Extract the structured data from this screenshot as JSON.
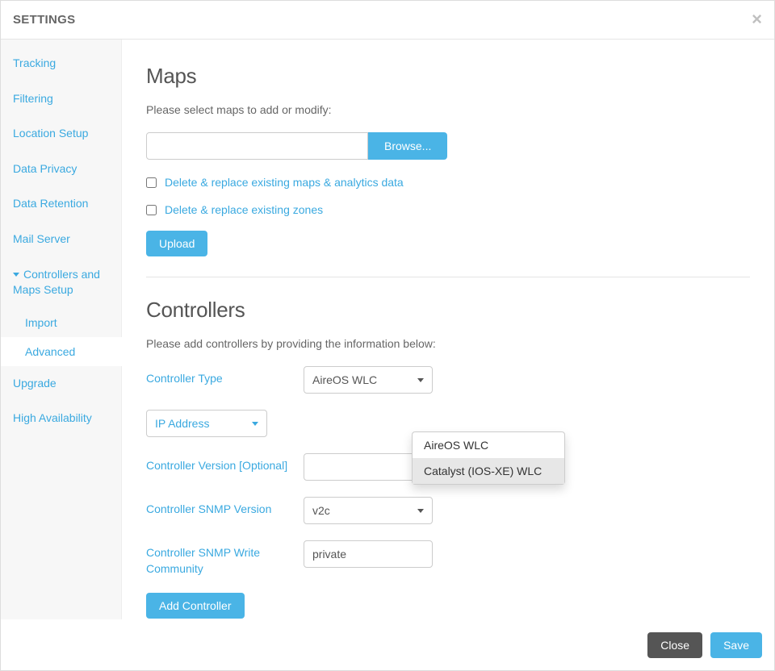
{
  "header": {
    "title": "SETTINGS"
  },
  "sidebar": {
    "items": [
      {
        "label": "Tracking"
      },
      {
        "label": "Filtering"
      },
      {
        "label": "Location Setup"
      },
      {
        "label": "Data Privacy"
      },
      {
        "label": "Data Retention"
      },
      {
        "label": "Mail Server"
      },
      {
        "label": "Controllers and Maps Setup"
      },
      {
        "label": "Upgrade"
      },
      {
        "label": "High Availability"
      }
    ],
    "sub": {
      "import": "Import",
      "advanced": "Advanced"
    }
  },
  "maps": {
    "title": "Maps",
    "helper": "Please select maps to add or modify:",
    "browse_label": "Browse...",
    "opt_replace_maps": "Delete & replace existing maps & analytics data",
    "opt_replace_zones": "Delete & replace existing zones",
    "upload_label": "Upload"
  },
  "controllers": {
    "title": "Controllers",
    "helper": "Please add controllers by providing the information below:",
    "type_label": "Controller Type",
    "type_value": "AireOS WLC",
    "type_options": {
      "a": "AireOS WLC",
      "b": "Catalyst (IOS-XE) WLC"
    },
    "ip_label": "IP Address",
    "version_label": "Controller Version [Optional]",
    "snmp_ver_label": "Controller SNMP Version",
    "snmp_ver_value": "v2c",
    "snmp_comm_label": "Controller SNMP Write Community",
    "snmp_comm_value": "private",
    "add_label": "Add Controller"
  },
  "footer": {
    "close": "Close",
    "save": "Save"
  }
}
